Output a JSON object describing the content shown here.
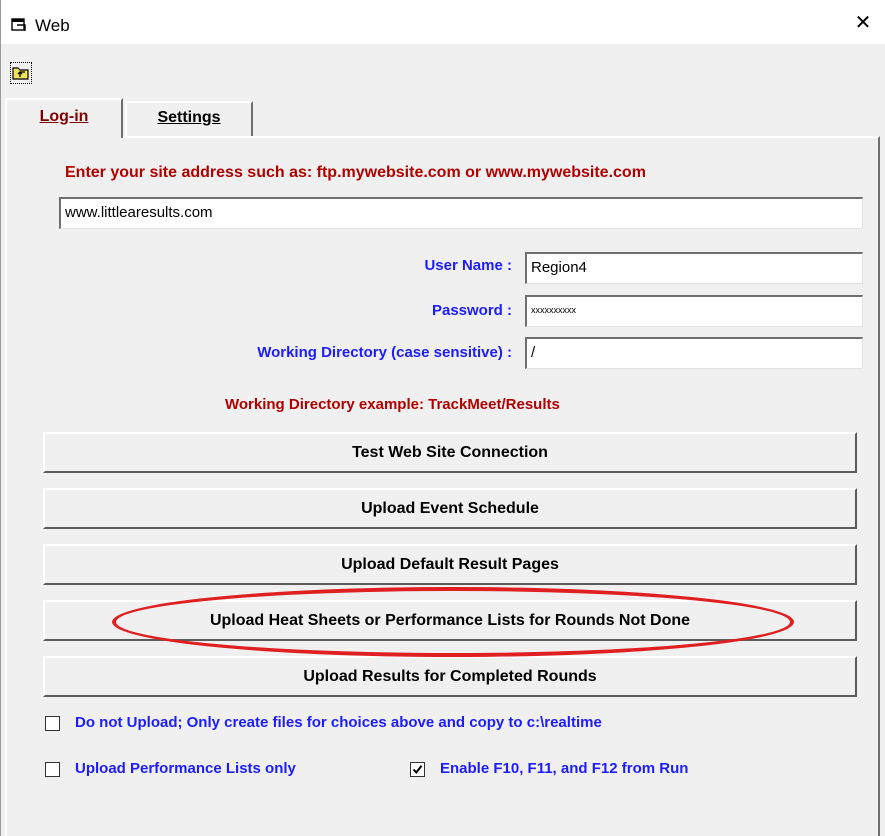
{
  "window": {
    "title": "Web",
    "icon": "web-window-icon",
    "close_icon": "close-icon",
    "close_symbol": "✕"
  },
  "toolbar": {
    "icon": "folder-up-icon"
  },
  "tabs": [
    {
      "label": "Log-in",
      "selected": true
    },
    {
      "label": "Settings",
      "selected": false
    }
  ],
  "login": {
    "site_prompt": "Enter your site address such as:  ftp.mywebsite.com or www.mywebsite.com",
    "site_value": "www.littlearesults.com",
    "user_name_label": "User Name :",
    "user_name_value": "Region4",
    "password_label": "Password :",
    "password_value": "xxxxxxxxxx",
    "working_dir_label": "Working Directory (case sensitive) :",
    "working_dir_value": "/",
    "working_dir_example": "Working Directory example:  TrackMeet/Results"
  },
  "buttons": {
    "test_connection": "Test Web Site Connection",
    "upload_schedule": "Upload Event Schedule",
    "upload_default": "Upload Default Result Pages",
    "upload_heat_sheets": "Upload Heat Sheets or Performance Lists for Rounds Not Done",
    "upload_results": "Upload Results for Completed Rounds"
  },
  "options": {
    "no_upload": {
      "label": "Do not Upload; Only create files for choices above and copy to c:\\realtime",
      "checked": false
    },
    "perf_lists_only": {
      "label": "Upload Performance Lists only",
      "checked": false
    },
    "enable_fkeys": {
      "label": "Enable F10, F11, and F12 from Run",
      "checked": true
    }
  },
  "colors": {
    "label_red": "#b00000",
    "label_blue": "#1c1cff",
    "highlight": "#e02020"
  }
}
